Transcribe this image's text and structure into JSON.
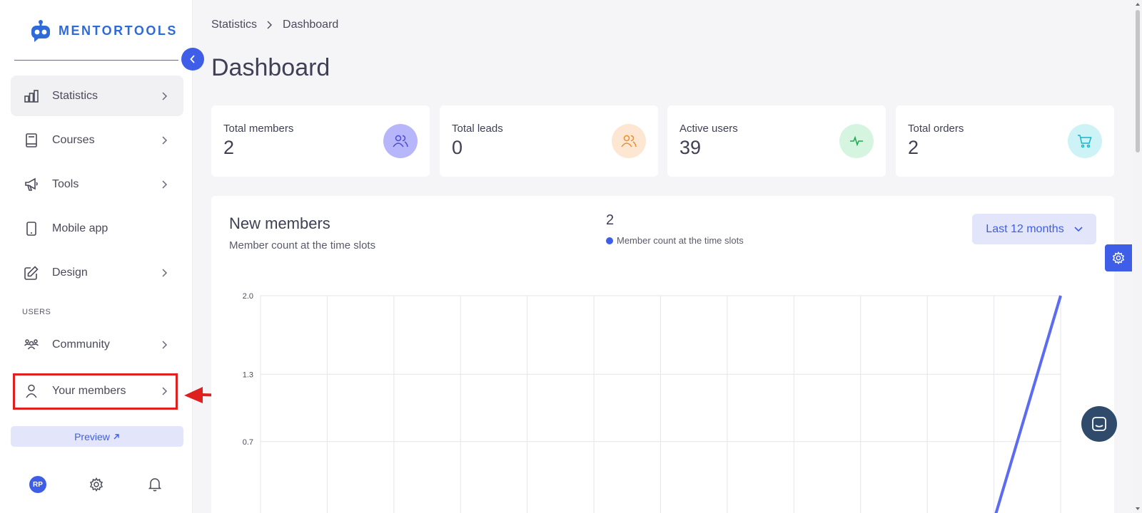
{
  "app": {
    "name": "MENTORTOOLS"
  },
  "sidebar": {
    "items": [
      {
        "label": "Statistics",
        "icon": "bar-chart-icon",
        "has_chevron": true,
        "active": true
      },
      {
        "label": "Courses",
        "icon": "book-icon",
        "has_chevron": true
      },
      {
        "label": "Tools",
        "icon": "megaphone-icon",
        "has_chevron": true
      },
      {
        "label": "Mobile app",
        "icon": "phone-icon",
        "has_chevron": false
      },
      {
        "label": "Design",
        "icon": "pencil-edit-icon",
        "has_chevron": true
      },
      {
        "label": "Community",
        "icon": "people-group-icon",
        "has_chevron": true
      },
      {
        "label": "Your members",
        "icon": "user-icon",
        "has_chevron": true
      }
    ],
    "section_users": "USERS",
    "preview_label": "Preview",
    "avatar_initials": "RP"
  },
  "breadcrumb": [
    "Statistics",
    "Dashboard"
  ],
  "page": {
    "title": "Dashboard"
  },
  "stats": [
    {
      "label": "Total members",
      "value": "2",
      "icon": "users-icon",
      "color": "#b8b6fb"
    },
    {
      "label": "Total leads",
      "value": "0",
      "icon": "users-icon",
      "color": "#fde7d2"
    },
    {
      "label": "Active users",
      "value": "39",
      "icon": "activity-icon",
      "color": "#d5f5e0"
    },
    {
      "label": "Total orders",
      "value": "2",
      "icon": "cart-icon",
      "color": "#cdf3f7"
    }
  ],
  "new_members": {
    "title": "New members",
    "subtitle": "Member count at the time slots",
    "total": "2",
    "legend": "Member count at the time slots",
    "range": "Last 12 months"
  },
  "chart_data": {
    "type": "line",
    "title": "New members",
    "ylim": [
      0,
      2.0
    ],
    "y_ticks": [
      "2.0",
      "1.3",
      "0.7"
    ],
    "series": [
      {
        "name": "Member count at the time slots",
        "values": [
          0,
          0,
          0,
          0,
          0,
          0,
          0,
          0,
          0,
          0,
          0,
          0,
          2
        ]
      }
    ],
    "grid": true,
    "color": "#5b6cf0"
  },
  "colors": {
    "accent": "#3f5ee8",
    "annotation": "#e01f1f"
  }
}
